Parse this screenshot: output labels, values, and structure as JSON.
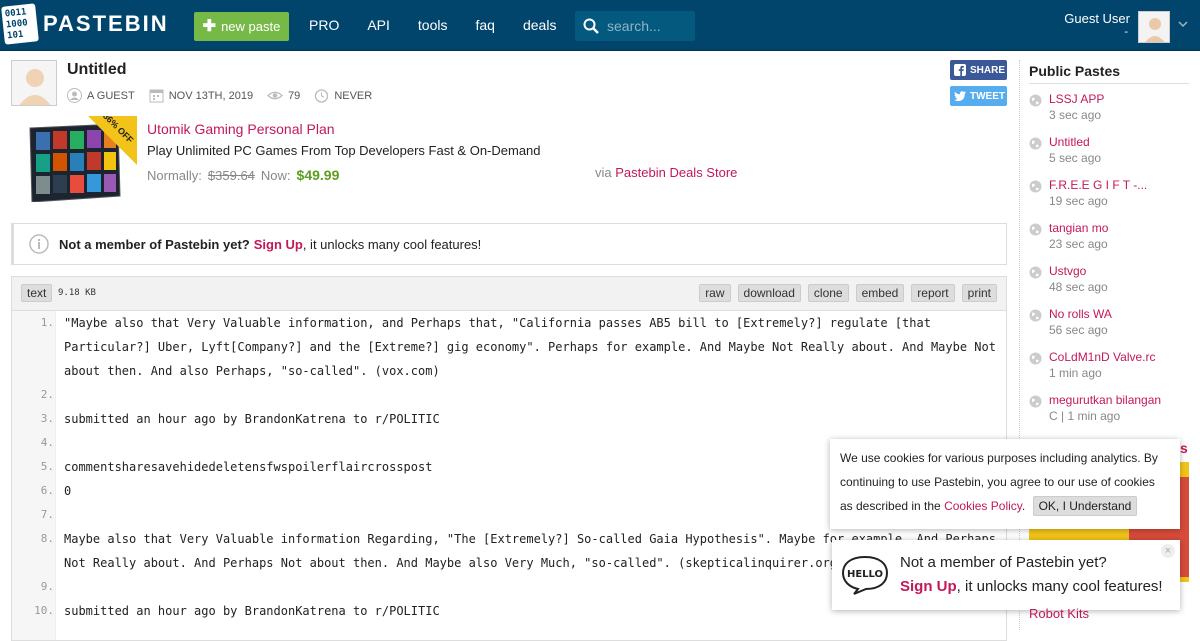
{
  "header": {
    "logo_text": "PASTEBIN",
    "logo_bits": [
      "0011",
      "1000",
      "101"
    ],
    "new_paste_label": "new paste",
    "nav": [
      "PRO",
      "API",
      "tools",
      "faq",
      "deals"
    ],
    "search_placeholder": "search...",
    "user_name": "Guest User",
    "user_sub": "-"
  },
  "paste": {
    "title": "Untitled",
    "author": "A GUEST",
    "date": "NOV 13TH, 2019",
    "views": "79",
    "expiry": "NEVER",
    "share_label": "SHARE",
    "tweet_label": "TWEET",
    "syntax": "text",
    "size": "9.18 KB",
    "tools": [
      "raw",
      "download",
      "clone",
      "embed",
      "report",
      "print"
    ]
  },
  "ad": {
    "badge": "86% OFF",
    "title": "Utomik Gaming Personal Plan",
    "subtitle": "Play Unlimited PC Games From Top Developers Fast & On-Demand",
    "normally_label": "Normally:",
    "old_price": "$359.64",
    "now_label": "Now:",
    "new_price": "$49.99",
    "via_label": "via",
    "store": "Pastebin Deals Store"
  },
  "notice": {
    "question": "Not a member of Pastebin yet?",
    "signup": "Sign Up",
    "rest": ", it unlocks many cool features!"
  },
  "code_lines": [
    {
      "n": "1.",
      "t": "\"Maybe also that Very Valuable information, and Perhaps that, \"California passes AB5 bill to [Extremely?] regulate [that Particular?] Uber, Lyft[Company?] and the [Extreme?] gig economy\". Perhaps for example. And Maybe Not Really about. And Maybe Not about then. And also Perhaps, \"so-called\". (vox.com)"
    },
    {
      "n": "2.",
      "t": ""
    },
    {
      "n": "3.",
      "t": "submitted an hour ago by BrandonKatrena to r/POLITIC"
    },
    {
      "n": "4.",
      "t": ""
    },
    {
      "n": "5.",
      "t": "commentsharesavehidedeletensfwspoilerflaircrosspost"
    },
    {
      "n": "6.",
      "t": "0"
    },
    {
      "n": "7.",
      "t": ""
    },
    {
      "n": "8.",
      "t": "Maybe also that Very Valuable information Regarding, \"The [Extremely?] So-called Gaia Hypothesis\". Maybe for example. And Perhaps Not Really about. And Perhaps Not about then. And Maybe also Very Much, \"so-called\". (skepticalinquirer.org)"
    },
    {
      "n": "9.",
      "t": ""
    },
    {
      "n": "10.",
      "t": "submitted an hour ago by BrandonKatrena to r/POLITIC"
    }
  ],
  "sidebar": {
    "title": "Public Pastes",
    "items": [
      {
        "name": "LSSJ APP",
        "time": "3 sec ago"
      },
      {
        "name": "Untitled",
        "time": "5 sec ago"
      },
      {
        "name": "F.R.E.E G I F T -...",
        "time": "19 sec ago"
      },
      {
        "name": "tangian mo",
        "time": "23 sec ago"
      },
      {
        "name": "Ustvgo",
        "time": "48 sec ago"
      },
      {
        "name": "No rolls WA",
        "time": "56 sec ago"
      },
      {
        "name": "CoLdM1nD Valve.rc",
        "time": "1 min ago"
      },
      {
        "name": "megurutkan bilangan",
        "time": "C | 1 min ago"
      }
    ],
    "peek_letter": "s",
    "bottom_link": "Robot Kits"
  },
  "cookie": {
    "text": "We use cookies for various purposes including analytics. By continuing to use Pastebin, you agree to our use of cookies as described in the",
    "link": "Cookies Policy",
    "period": ".",
    "ok": "OK, I Understand"
  },
  "member_popup": {
    "hello": "HELLO",
    "line1": "Not a member of Pastebin yet?",
    "signup": "Sign Up",
    "rest": ", it unlocks many cool features!",
    "close": "×"
  }
}
